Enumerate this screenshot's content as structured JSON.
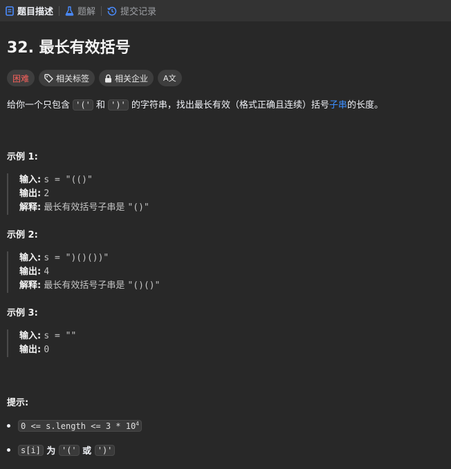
{
  "tabs": [
    {
      "label": "题目描述",
      "icon": "document-icon"
    },
    {
      "label": "题解",
      "icon": "flask-icon"
    },
    {
      "label": "提交记录",
      "icon": "history-icon"
    }
  ],
  "problem": {
    "title": "32. 最长有效括号",
    "tags": {
      "difficulty": "困难",
      "related_tags": "相关标签",
      "related_companies": "相关企业",
      "translate": "A文"
    },
    "description": {
      "part1": "给你一个只包含 ",
      "code1": "'('",
      "part2": " 和 ",
      "code2": "')'",
      "part3": " 的字符串，找出最长有效（格式正确且连续）括号",
      "link": "子串",
      "part4": "的长度。"
    }
  },
  "examples": [
    {
      "title": "示例 1:",
      "input_label": "输入:",
      "input": "s = \"(()\"",
      "output_label": "输出:",
      "output": "2",
      "explain_label": "解释:",
      "explain_text": "最长有效括号子串是 ",
      "explain_code": "\"()\""
    },
    {
      "title": "示例 2:",
      "input_label": "输入:",
      "input": "s = \")()())\"",
      "output_label": "输出:",
      "output": "4",
      "explain_label": "解释:",
      "explain_text": "最长有效括号子串是 ",
      "explain_code": "\"()()\""
    },
    {
      "title": "示例 3:",
      "input_label": "输入:",
      "input": "s = \"\"",
      "output_label": "输出:",
      "output": "0"
    }
  ],
  "hints": {
    "title": "提示:",
    "constraint1_code": "0 <= s.length <= 3 * 10",
    "constraint1_sup": "4",
    "constraint2_code1": "s[i]",
    "constraint2_text1": " 为 ",
    "constraint2_code2": "'('",
    "constraint2_text2": " 或 ",
    "constraint2_code3": "')'"
  },
  "colors": {
    "background": "#282828",
    "tabbar": "#333333",
    "hard": "#f8615c",
    "link": "#3c8fff"
  }
}
